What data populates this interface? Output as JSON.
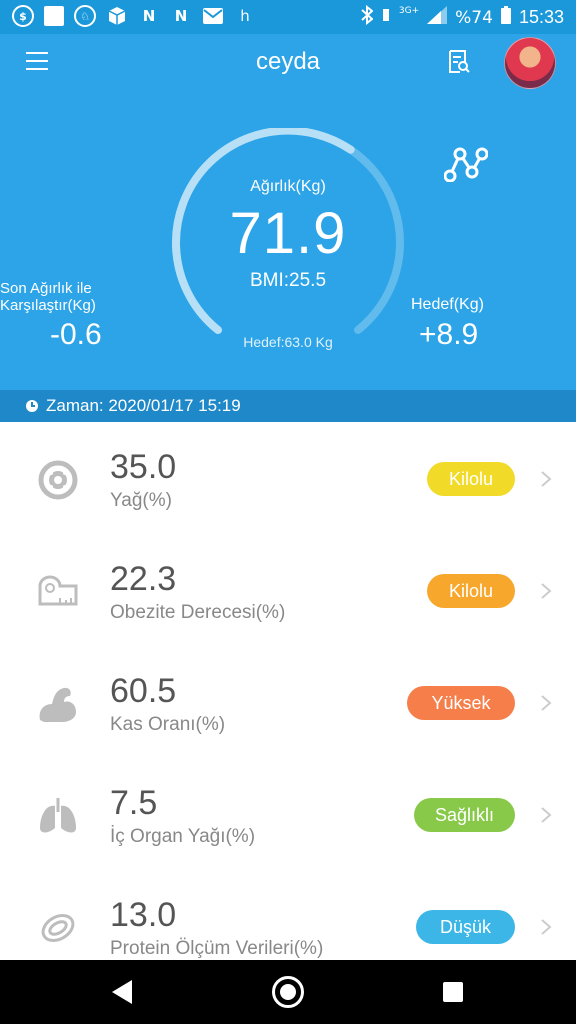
{
  "status_bar": {
    "left_icons": [
      "sim-icon",
      "square-icon",
      "app-icon",
      "box-icon",
      "n-icon",
      "n-icon",
      "mail-icon",
      "h-icon"
    ],
    "n_glyph": "N",
    "h_glyph": "h",
    "network": "3G+",
    "battery": "%74",
    "time": "15:33"
  },
  "header": {
    "title": "ceyda",
    "weight_label": "Ağırlık(Kg)",
    "weight_value": "71.9",
    "bmi": "BMI:25.5",
    "target_text": "Hedef:63.0 Kg",
    "compare_label": "Son Ağırlık ile Karşılaştır(Kg)",
    "compare_value": "-0.6",
    "goal_label": "Hedef(Kg)",
    "goal_value": "+8.9",
    "gauge_progress": 0.62,
    "colors": {
      "bg": "#2CA4E7",
      "timebar": "#1F88C9"
    }
  },
  "time": {
    "text": "Zaman: 2020/01/17 15:19"
  },
  "metrics": [
    {
      "value": "35.0",
      "label": "Yağ(%)",
      "status": "Kilolu",
      "color": "#F2DA28",
      "icon": "fat-icon"
    },
    {
      "value": "22.3",
      "label": "Obezite Derecesi(%)",
      "status": "Kilolu",
      "color": "#F7A82C",
      "icon": "tape-measure-icon"
    },
    {
      "value": "60.5",
      "label": "Kas Oranı(%)",
      "status": "Yüksek",
      "color": "#F67E4A",
      "icon": "muscle-icon"
    },
    {
      "value": "7.5",
      "label": "İç Organ Yağı(%)",
      "status": "Sağlıklı",
      "color": "#88C94A",
      "icon": "lungs-icon"
    },
    {
      "value": "13.0",
      "label": "Protein Ölçüm Verileri(%)",
      "status": "Düşük",
      "color": "#3CB6E6",
      "icon": "protein-icon"
    }
  ]
}
